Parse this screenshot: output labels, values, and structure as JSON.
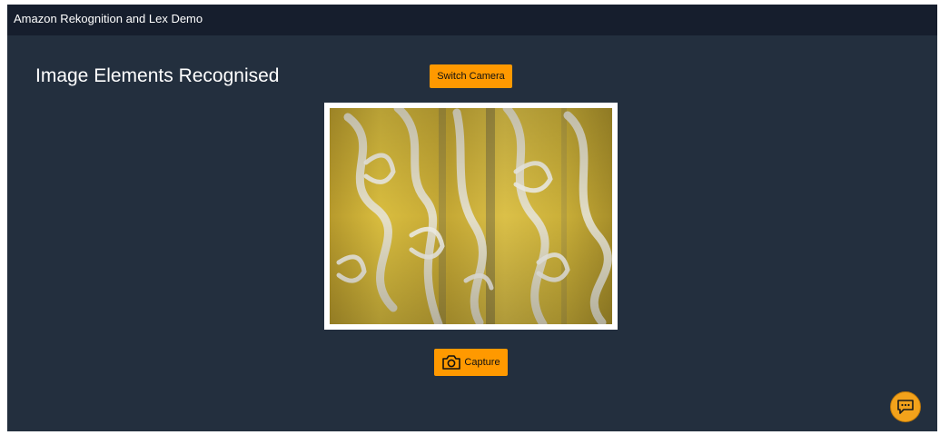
{
  "header": {
    "title": "Amazon Rekognition and Lex Demo"
  },
  "main": {
    "title": "Image Elements Recognised",
    "switch_camera_label": "Switch Camera",
    "capture_label": "Capture"
  },
  "icons": {
    "capture": "camera-icon",
    "chat": "chat-bubble-icon"
  },
  "colors": {
    "header_bg": "#161e2d",
    "page_bg": "#232f3e",
    "accent": "#ff9900",
    "chat_button": "#f3a21b"
  }
}
